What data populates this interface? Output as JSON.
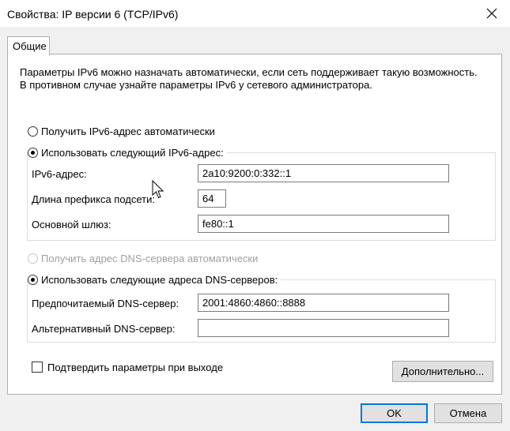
{
  "window": {
    "title": "Свойства: IP версии 6 (TCP/IPv6)",
    "close_icon": "close-icon"
  },
  "tabs": [
    {
      "label": "Общие",
      "active": true
    }
  ],
  "description": "Параметры IPv6 можно назначать автоматически, если сеть поддерживает такую возможность. В противном случае узнайте параметры IPv6 у сетевого администратора.",
  "ip": {
    "auto_label": "Получить IPv6-адрес автоматически",
    "auto_checked": false,
    "manual_label": "Использовать следующий IPv6-адрес:",
    "manual_checked": true,
    "address_label": "IPv6-адрес:",
    "address_value": "2a10:9200:0:332::1",
    "prefix_label": "Длина префикса подсети:",
    "prefix_value": "64",
    "gateway_label": "Основной шлюз:",
    "gateway_value": "fe80::1"
  },
  "dns": {
    "auto_label": "Получить адрес DNS-сервера автоматически",
    "auto_checked": false,
    "auto_disabled": true,
    "manual_label": "Использовать следующие адреса DNS-серверов:",
    "manual_checked": true,
    "preferred_label": "Предпочитаемый DNS-сервер:",
    "preferred_value": "2001:4860:4860::8888",
    "alternate_label": "Альтернативный DNS-сервер:",
    "alternate_value": ""
  },
  "validate": {
    "label": "Подтвердить параметры при выходе",
    "checked": false
  },
  "buttons": {
    "advanced": "Дополнительно...",
    "ok": "OK",
    "cancel": "Отмена"
  }
}
